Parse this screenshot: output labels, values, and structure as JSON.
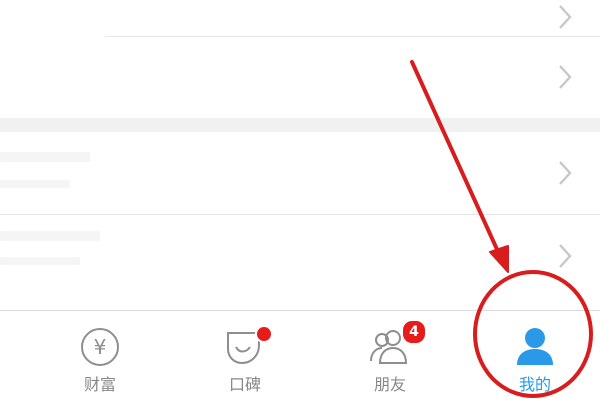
{
  "tabs": [
    {
      "label": "财富",
      "icon": "yuan-coin-icon"
    },
    {
      "label": "口碑",
      "icon": "koubei-icon",
      "badge": "dot"
    },
    {
      "label": "朋友",
      "icon": "friends-icon",
      "badge_count": "4"
    },
    {
      "label": "我的",
      "icon": "person-icon",
      "active": true
    }
  ],
  "yuan_symbol": "¥",
  "colors": {
    "active": "#2a9ae8",
    "inactive": "#888888",
    "badge": "#e81b1b",
    "annotation": "#d71d1d"
  },
  "annotation": {
    "type": "arrow-and-circle",
    "target": "我的"
  }
}
